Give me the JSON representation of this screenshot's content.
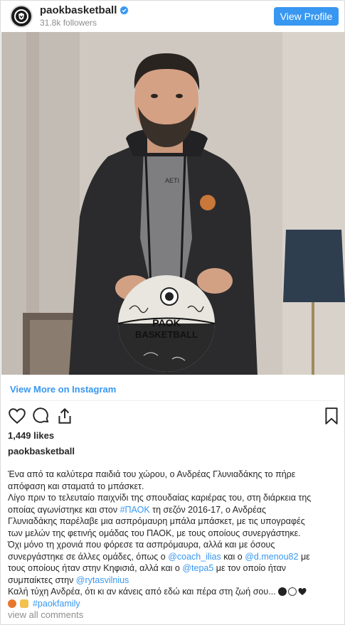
{
  "header": {
    "username": "paokbasketball",
    "followers": "31.8k followers",
    "view_profile": "View Profile"
  },
  "ball": {
    "text_line1": "PAOK",
    "text_line2": "BASKETBALL"
  },
  "shirt_text": "AETI",
  "view_more": "View More on Instagram",
  "likes": "1,449 likes",
  "owner": "paokbasketball",
  "caption": {
    "p1": "Ένα από τα καλύτερα παιδιά του χώρου, ο Ανδρέας Γλυνιαδάκης το πήρε",
    "p2": "απόφαση και σταματά το μπάσκετ.",
    "p3": "Λίγο πριν το τελευταίο παιχνίδι της σπουδαίας καριέρας του, στη διάρκεια της",
    "p4a": "οποίας αγωνίστηκε και στον ",
    "p4_tag": "#ΠΑΟΚ",
    "p4b": " τη σεζόν 2016-17, ο Ανδρέας",
    "p5": "Γλυνιαδάκης παρέλαβε μια ασπρόμαυρη μπάλα μπάσκετ, με τις υπογραφές",
    "p6": "των μελών της φετινής ομάδας του ΠΑΟΚ, με τους οποίους συνεργάστηκε.",
    "p7": "Όχι μόνο τη χρονιά που φόρεσε τα ασπρόμαυρα, αλλά και με όσους",
    "p8a": "συνεργάστηκε σε άλλες ομάδες, όπως ο ",
    "p8_m1": "@coach_ilias",
    "p8b": " και ο ",
    "p8_m2": "@d.menou82",
    "p8c": " με",
    "p9a": "τους οποίους ήταν στην Κηφισιά, αλλά και ο ",
    "p9_m3": "@tepa5",
    "p9b": " με τον οποίο ήταν",
    "p10a": "συμπαίκτες στην ",
    "p10_m4": "@rytasvilnius",
    "p11": "Καλή τύχη Ανδρέα, ότι κι αν κάνεις από εδώ και πέρα στη ζωή σου...",
    "p12_tag": "#paokfamily"
  },
  "view_comments": "view all comments",
  "colors": {
    "accent": "#3897f0",
    "text": "#262626",
    "muted": "#8e8e8e"
  },
  "icons": [
    "verified-badge-icon",
    "heart-icon",
    "comment-icon",
    "share-icon",
    "bookmark-icon"
  ]
}
